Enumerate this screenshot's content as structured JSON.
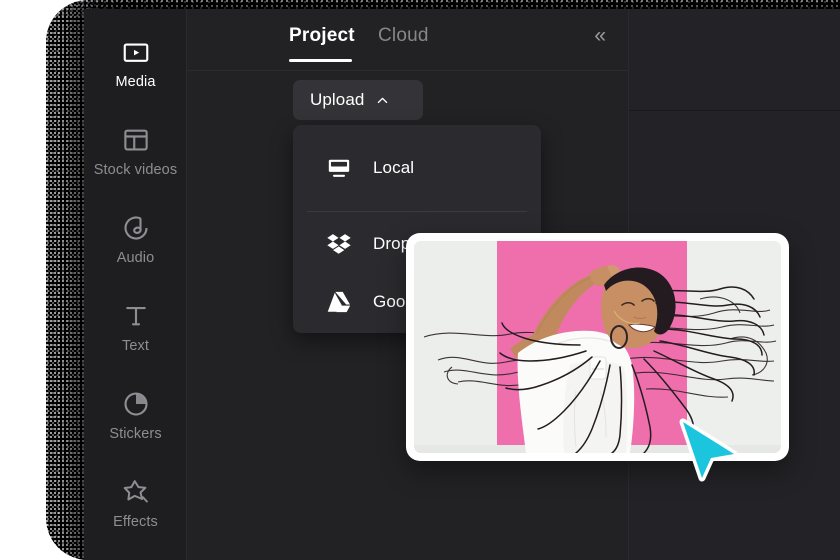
{
  "app": {
    "name": "video-editor",
    "colors": {
      "panel_bg": "#222124",
      "rail_bg": "#1e1d20",
      "menu_bg": "#2b2a2e",
      "button_bg": "#343438",
      "accent_white": "#ffffff",
      "muted_text": "#8d8d93",
      "cursor_cyan": "#1bc5dd",
      "photo_pink": "#ef6fad"
    }
  },
  "sidebar": {
    "items": [
      {
        "label": "Media",
        "icon": "media-play-rect-icon",
        "active": true
      },
      {
        "label": "Stock videos",
        "icon": "layout-grid-icon",
        "active": false
      },
      {
        "label": "Audio",
        "icon": "music-note-circle-icon",
        "active": false
      },
      {
        "label": "Text",
        "icon": "text-t-icon",
        "active": false
      },
      {
        "label": "Stickers",
        "icon": "sticker-circle-icon",
        "active": false
      },
      {
        "label": "Effects",
        "icon": "effects-star-icon",
        "active": false
      }
    ]
  },
  "panel": {
    "tabs": [
      {
        "label": "Project",
        "active": true
      },
      {
        "label": "Cloud",
        "active": false
      }
    ],
    "collapse_icon": "chevron-double-left-icon",
    "refresh_icon": "refresh-icon",
    "upload": {
      "label": "Upload",
      "chevron_icon": "chevron-up-icon",
      "expanded": true,
      "menu_items": [
        {
          "label": "Local",
          "icon": "monitor-icon"
        },
        {
          "label": "Dropbox",
          "icon": "dropbox-icon"
        },
        {
          "label": "Google Drive",
          "icon": "google-drive-icon"
        }
      ]
    }
  },
  "preview_card": {
    "alt": "woman with long braids dancing against pink and white wall",
    "cursor_icon": "cursor-arrow-icon"
  }
}
